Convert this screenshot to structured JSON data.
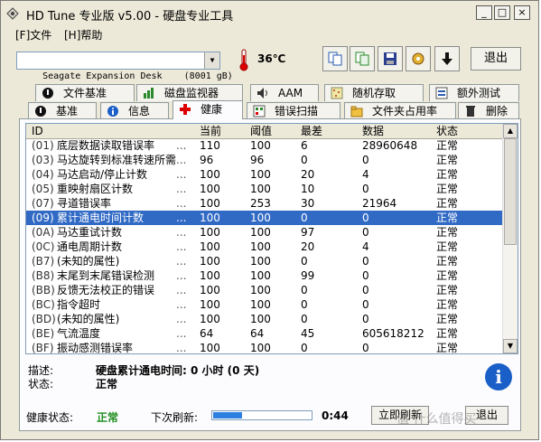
{
  "window": {
    "title": "HD Tune 专业版 v5.00 - 硬盘专业工具",
    "btn_min": "_",
    "btn_max": "□",
    "btn_close": "×"
  },
  "menu": {
    "file": "[F]文件",
    "help": "[H]帮助"
  },
  "toolbar": {
    "drive": "Seagate Expansion Desk    (8001 gB)",
    "temperature": "36℃",
    "exit_label": "退出"
  },
  "tabs_top": [
    {
      "label": "文件基准",
      "icon": "file-benchmark-icon"
    },
    {
      "label": "磁盘监视器",
      "icon": "disk-monitor-icon"
    },
    {
      "label": "AAM",
      "icon": "speaker-icon"
    },
    {
      "label": "随机存取",
      "icon": "random-access-icon"
    },
    {
      "label": "额外测试",
      "icon": "extra-tests-icon"
    }
  ],
  "tabs_bottom": [
    {
      "label": "基准",
      "icon": "benchmark-icon"
    },
    {
      "label": "信息",
      "icon": "info-icon"
    },
    {
      "label": "健康",
      "icon": "health-cross-icon"
    },
    {
      "label": "错误扫描",
      "icon": "error-scan-icon"
    },
    {
      "label": "文件夹占用率",
      "icon": "folder-icon"
    },
    {
      "label": "删除",
      "icon": "trash-icon"
    }
  ],
  "table": {
    "headers": {
      "id": "ID",
      "current": "当前",
      "threshold": "阈值",
      "worst": "最差",
      "data": "数据",
      "status": "状态"
    },
    "rows": [
      {
        "id": "(01)",
        "name": "底层数据读取错误率",
        "current": "110",
        "threshold": "100",
        "worst": "6",
        "data": "28960648",
        "status": "正常"
      },
      {
        "id": "(03)",
        "name": "马达旋转到标准转速所需",
        "current": "96",
        "threshold": "96",
        "worst": "0",
        "data": "0",
        "status": "正常"
      },
      {
        "id": "(04)",
        "name": "马达启动/停止计数",
        "current": "100",
        "threshold": "100",
        "worst": "20",
        "data": "4",
        "status": "正常"
      },
      {
        "id": "(05)",
        "name": "重映射扇区计数",
        "current": "100",
        "threshold": "100",
        "worst": "10",
        "data": "0",
        "status": "正常"
      },
      {
        "id": "(07)",
        "name": "寻道错误率",
        "current": "100",
        "threshold": "253",
        "worst": "30",
        "data": "21964",
        "status": "正常"
      },
      {
        "id": "(09)",
        "name": "累计通电时间计数",
        "current": "100",
        "threshold": "100",
        "worst": "0",
        "data": "0",
        "status": "正常"
      },
      {
        "id": "(0A)",
        "name": "马达重试计数",
        "current": "100",
        "threshold": "100",
        "worst": "97",
        "data": "0",
        "status": "正常"
      },
      {
        "id": "(0C)",
        "name": "通电周期计数",
        "current": "100",
        "threshold": "100",
        "worst": "20",
        "data": "4",
        "status": "正常"
      },
      {
        "id": "(B7)",
        "name": "(未知的属性)",
        "current": "100",
        "threshold": "100",
        "worst": "0",
        "data": "0",
        "status": "正常"
      },
      {
        "id": "(B8)",
        "name": "末尾到末尾错误检测",
        "current": "100",
        "threshold": "100",
        "worst": "99",
        "data": "0",
        "status": "正常"
      },
      {
        "id": "(BB)",
        "name": "反馈无法校正的错误",
        "current": "100",
        "threshold": "100",
        "worst": "0",
        "data": "0",
        "status": "正常"
      },
      {
        "id": "(BC)",
        "name": "指令超时",
        "current": "100",
        "threshold": "100",
        "worst": "0",
        "data": "0",
        "status": "正常"
      },
      {
        "id": "(BD)",
        "name": "(未知的属性)",
        "current": "100",
        "threshold": "100",
        "worst": "0",
        "data": "0",
        "status": "正常"
      },
      {
        "id": "(BE)",
        "name": "气流温度",
        "current": "64",
        "threshold": "64",
        "worst": "45",
        "data": "605618212",
        "status": "正常"
      },
      {
        "id": "(BF)",
        "name": "振动感测错误率",
        "current": "100",
        "threshold": "100",
        "worst": "0",
        "data": "0",
        "status": "正常"
      }
    ],
    "dots": "...",
    "selected_row_index": 5
  },
  "detail": {
    "desc_label": "描述:",
    "desc_value": "硬盘累计通电时间: 0 小时 (0 天)",
    "status_label": "状态:",
    "status_value": "正常"
  },
  "footer": {
    "health_label": "健康状态:",
    "health_value": "正常",
    "next_refresh_label": "下次刷新:",
    "countdown": "0:44",
    "refresh_progress": 0.3,
    "refresh_button": "立即刷新",
    "exit_button": "退出"
  },
  "watermark": "值 什么值得买",
  "colors": {
    "selected_row": "#316ac5",
    "health_ok": "#1c8c1c",
    "progress": "#2d7fe0"
  }
}
